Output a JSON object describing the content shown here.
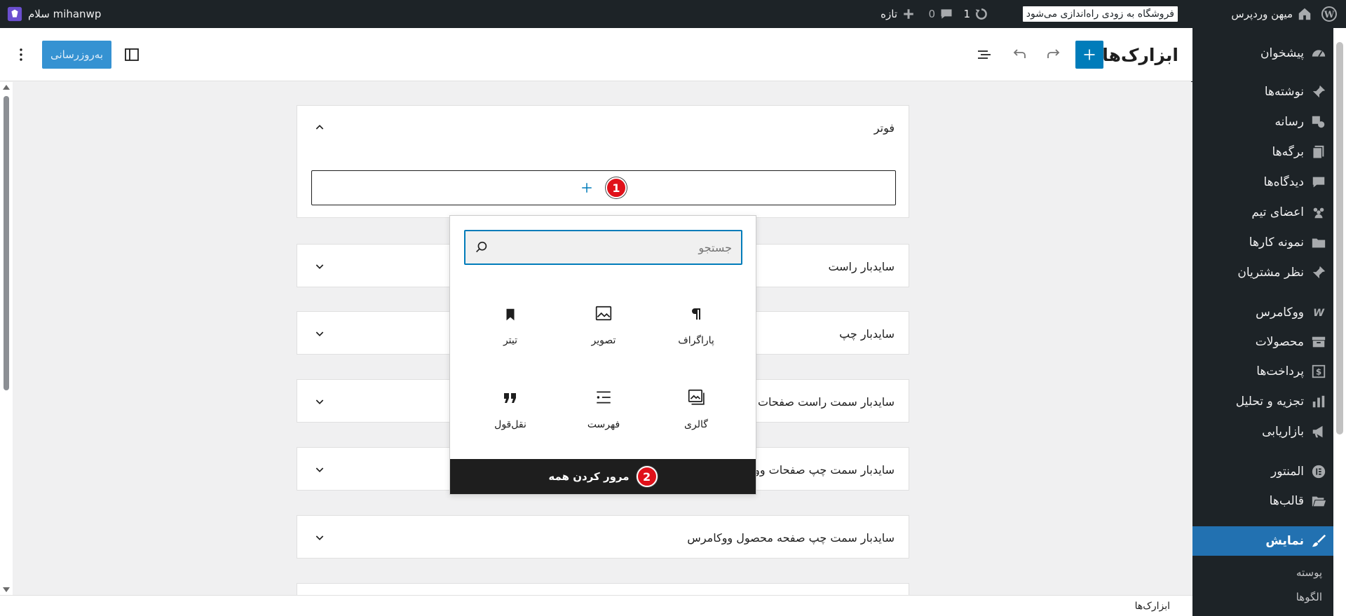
{
  "adminbar": {
    "site_name": "میهن وردپرس",
    "notice": "فروشگاه به زودی راه‌اندازی می‌شود",
    "updates_count": "1",
    "comments_count": "0",
    "new_label": "تازه",
    "greeting": "سلام mihanwp"
  },
  "menu": {
    "items": [
      {
        "label": "پیشخوان",
        "icon": "dashboard-icon"
      },
      {
        "label": "نوشته‌ها",
        "icon": "pin-icon"
      },
      {
        "label": "رسانه",
        "icon": "media-icon"
      },
      {
        "label": "برگه‌ها",
        "icon": "pages-icon"
      },
      {
        "label": "دیدگاه‌ها",
        "icon": "comment-icon"
      },
      {
        "label": "اعضای تیم",
        "icon": "groups-icon"
      },
      {
        "label": "نمونه کارها",
        "icon": "folder-icon"
      },
      {
        "label": "نظر مشتریان",
        "icon": "pin-icon"
      },
      {
        "label": "ووکامرس",
        "icon": "woo-icon"
      },
      {
        "label": "محصولات",
        "icon": "archive-icon"
      },
      {
        "label": "پرداخت‌ها",
        "icon": "dollar-icon"
      },
      {
        "label": "تجزیه و تحلیل",
        "icon": "chart-icon"
      },
      {
        "label": "بازاریابی",
        "icon": "megaphone-icon"
      },
      {
        "label": "المنتور",
        "icon": "elementor-icon"
      },
      {
        "label": "قالب‌ها",
        "icon": "folder-open-icon"
      },
      {
        "label": "نمایش",
        "icon": "brush-icon"
      }
    ],
    "submenu": [
      "پوسته",
      "الگوها"
    ]
  },
  "header": {
    "title": "ابزارک‌ها",
    "update_label": "به‌روزرسانی"
  },
  "panels": [
    {
      "title": "فوتر"
    },
    {
      "title": "سایدبار راست"
    },
    {
      "title": "سایدبار چپ"
    },
    {
      "title": "سایدبار سمت راست صفحات و"
    },
    {
      "title": "سایدبار سمت چپ صفحات وو"
    },
    {
      "title": "سایدبار سمت چپ صفحه محصول ووکامرس"
    }
  ],
  "badges": {
    "one": "1",
    "two": "2"
  },
  "inserter": {
    "search_placeholder": "جستجو",
    "blocks": [
      {
        "label": "پاراگراف",
        "icon": "paragraph-icon"
      },
      {
        "label": "تصویر",
        "icon": "image-icon"
      },
      {
        "label": "تیتر",
        "icon": "bookmark-icon"
      },
      {
        "label": "گالری",
        "icon": "gallery-icon"
      },
      {
        "label": "فهرست",
        "icon": "list-icon"
      },
      {
        "label": "نقل‌قول",
        "icon": "quote-icon"
      }
    ],
    "browse_all": "مرور کردن همه"
  },
  "footer": {
    "breadcrumb": "ابزارک‌ها"
  }
}
